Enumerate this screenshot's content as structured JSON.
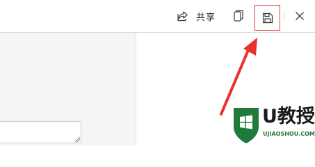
{
  "toolbar": {
    "share_label": "共享",
    "share_icon": "share-icon",
    "copy_icon": "copy-icon",
    "save_icon": "save-icon",
    "close_icon": "close-icon",
    "highlight_color": "#d83a3a"
  },
  "annotation": {
    "arrow_color": "#e8322f"
  },
  "watermark": {
    "brand_text": "U教授",
    "domain_text": "UJIAOSHOU.COM",
    "brand_color": "#1f7a3b"
  }
}
